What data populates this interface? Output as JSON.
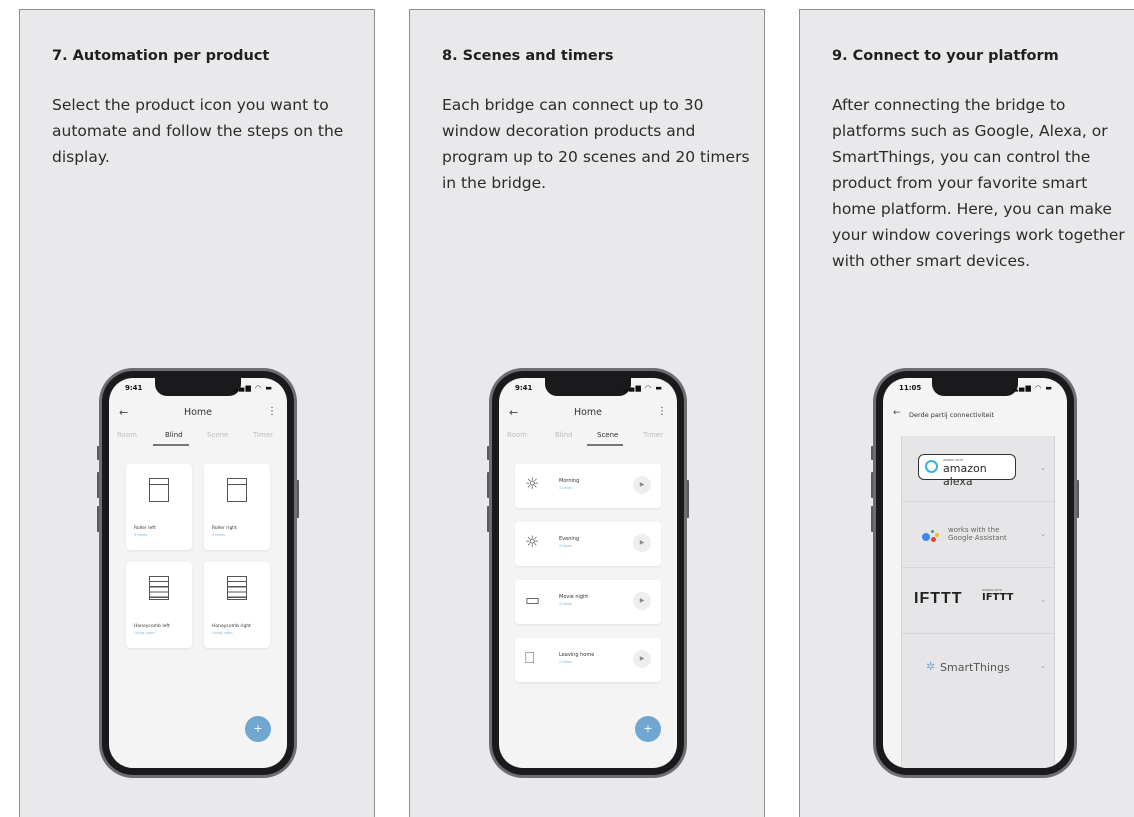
{
  "cards": [
    {
      "title": "7. Automation per product",
      "body": "Select the product icon you want to automate and follow the steps on the display.",
      "phone": {
        "time": "9:41",
        "status_icons": "signal-wifi-battery",
        "header_title": "Home",
        "tabs": [
          "Room",
          "Blind",
          "Scene",
          "Timer"
        ],
        "active_tab": "Blind",
        "products": [
          {
            "name": "Roller left",
            "sub": "0 times",
            "icon": "roller-blind-icon"
          },
          {
            "name": "Roller right",
            "sub": "0 times",
            "icon": "roller-blind-icon"
          },
          {
            "name": "Honeycomb left",
            "sub": "Living room",
            "icon": "honeycomb-blind-icon"
          },
          {
            "name": "Honeycomb right",
            "sub": "Living room",
            "icon": "honeycomb-blind-icon"
          }
        ],
        "fab": "+"
      }
    },
    {
      "title": "8. Scenes and timers",
      "body": "Each bridge can connect up to 30 window decoration products and program up to 20 scenes and 20 timers in the bridge.",
      "phone": {
        "time": "9:41",
        "header_title": "Home",
        "tabs": [
          "Room",
          "Blind",
          "Scene",
          "Timer"
        ],
        "active_tab": "Scene",
        "scenes": [
          {
            "name": "Morning",
            "sub": "4 times",
            "icon": "sunrise-icon"
          },
          {
            "name": "Evening",
            "sub": "3 times",
            "icon": "sunset-icon"
          },
          {
            "name": "Movie night",
            "sub": "2 times",
            "icon": "tv-icon"
          },
          {
            "name": "Leaving home",
            "sub": "2 times",
            "icon": "leaving-home-icon"
          }
        ],
        "fab": "+"
      }
    },
    {
      "title": "9. Connect to your platform",
      "body": "After connecting the bridge to platforms such as Google, Alexa, or SmartThings, you can control the product from your favorite smart home platform. Here, you can make your window coverings work together with other smart devices.",
      "phone": {
        "time": "11:05",
        "header_title": "Derde partij connectiviteit",
        "platforms": {
          "alexa": {
            "works": "WORKS WITH",
            "name": "amazon alexa"
          },
          "google": {
            "line1": "works with the",
            "line2": "Google Assistant"
          },
          "ifttt": {
            "logo": "IFTTT",
            "works": "WORKS WITH",
            "name": "IFTTT"
          },
          "smartthings": {
            "name": "SmartThings"
          }
        }
      }
    }
  ],
  "colors": {
    "card_bg": "#e9e9eb",
    "fab": "#6fa7d1",
    "link_blue": "#7ab3d8",
    "alexa_ring": "#35b1e3"
  }
}
